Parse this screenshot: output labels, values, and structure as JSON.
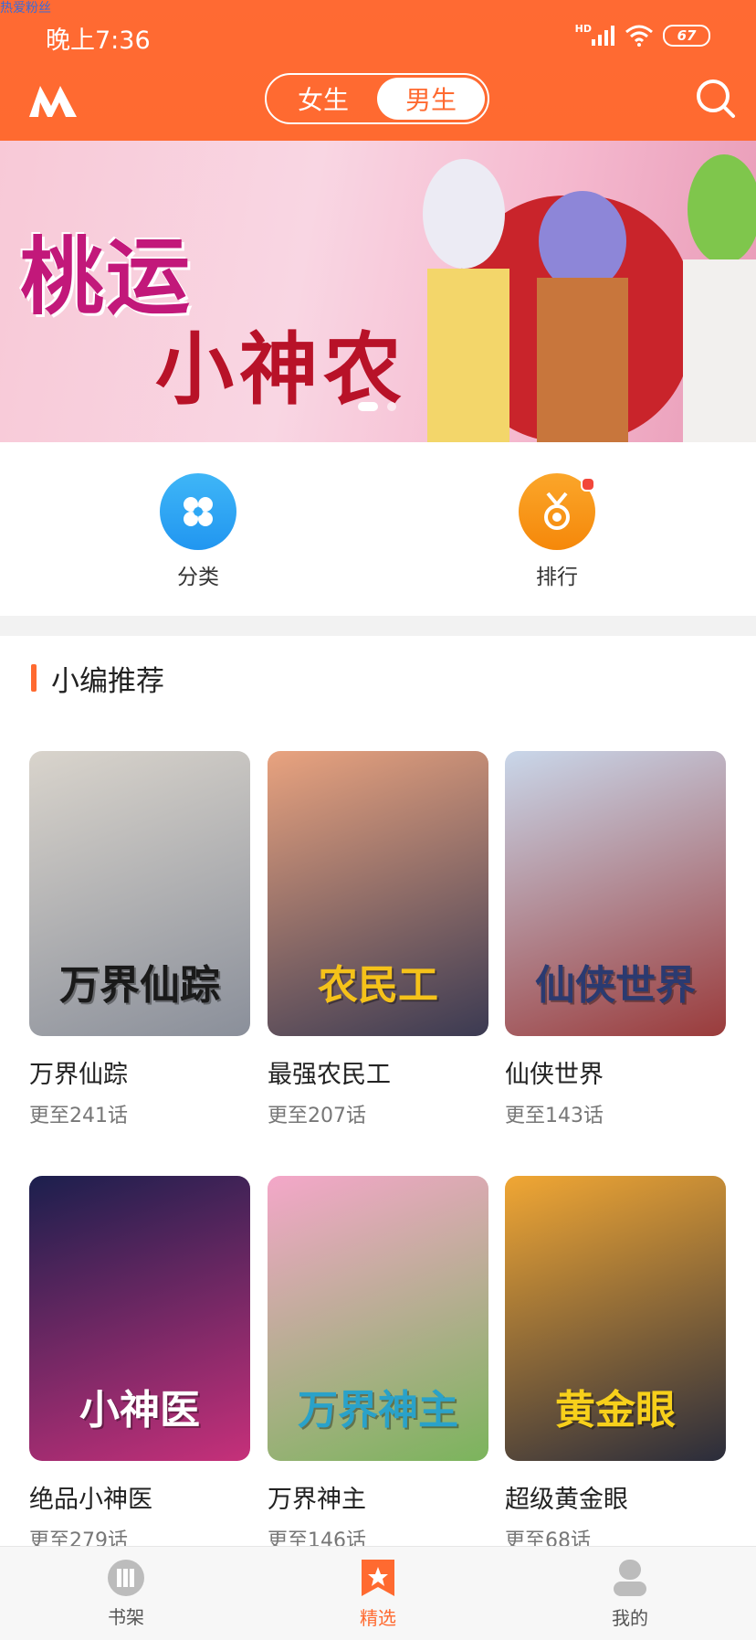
{
  "status_bar": {
    "watermark": "热爱粉丝",
    "time": "晚上7:36",
    "network": "HD",
    "battery": "67"
  },
  "header": {
    "tabs": [
      {
        "label": "女生",
        "active": false
      },
      {
        "label": "男生",
        "active": true
      }
    ]
  },
  "banner": {
    "title": "桃运",
    "subtitle": "小神农",
    "page_count": 2,
    "active_page": 1
  },
  "shortcuts": [
    {
      "label": "分类",
      "icon": "category-icon",
      "color": "#2ea8f5",
      "badge": false
    },
    {
      "label": "排行",
      "icon": "medal-icon",
      "color": "#f7940c",
      "badge": true
    }
  ],
  "section": {
    "title": "小编推荐"
  },
  "comics": [
    {
      "title": "万界仙踪",
      "progress": "更至241话",
      "cover_text": "万界仙踪",
      "colors": [
        "#d9d4cc",
        "#8a8f9a"
      ],
      "text_color": "#1a1a1a"
    },
    {
      "title": "最强农民工",
      "progress": "更至207话",
      "cover_text": "农民工",
      "colors": [
        "#e9a37f",
        "#3b3a52"
      ],
      "text_color": "#f5c21a"
    },
    {
      "title": "仙侠世界",
      "progress": "更至143话",
      "cover_text": "仙侠世界",
      "colors": [
        "#c9d7ea",
        "#9a3b3b"
      ],
      "text_color": "#2b3a70"
    },
    {
      "title": "绝品小神医",
      "progress": "更至279话",
      "cover_text": "小神医",
      "colors": [
        "#1b1f4d",
        "#c6307a"
      ],
      "text_color": "#ffffff"
    },
    {
      "title": "万界神主",
      "progress": "更至146话",
      "cover_text": "万界神主",
      "colors": [
        "#f4a7c9",
        "#7bb45c"
      ],
      "text_color": "#2aa2c9"
    },
    {
      "title": "超级黄金眼",
      "progress": "更至68话",
      "cover_text": "黄金眼",
      "colors": [
        "#f1a734",
        "#2a2c3b"
      ],
      "text_color": "#f7d01b"
    }
  ],
  "tabbar": [
    {
      "label": "书架",
      "icon": "bookshelf-icon",
      "active": false
    },
    {
      "label": "精选",
      "icon": "featured-star-icon",
      "active": true
    },
    {
      "label": "我的",
      "icon": "profile-icon",
      "active": false
    }
  ]
}
